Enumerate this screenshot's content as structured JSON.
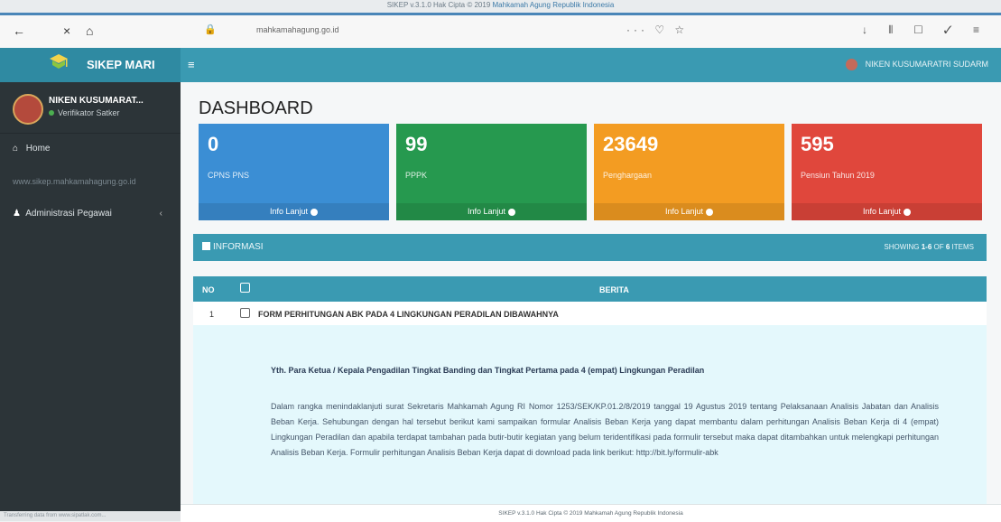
{
  "window": {
    "title_prefix": "SIKEP v.3.1.0 Hak Cipta © 2019",
    "title_org": "Mahkamah Agung Republik Indonesia"
  },
  "browser": {
    "back_icon": "arrow-left-icon",
    "close_icon": "close-icon",
    "home_icon": "home-icon",
    "url": "mahkamahagung.go.id",
    "actions": "··· ♡ ☆",
    "toolbar_icons": "↓ ⫴ ☐ ✓ ≡"
  },
  "app": {
    "brand": "SIKEP MARI",
    "menu_toggle": "≡",
    "top_user": "NIKEN KUSUMARATRI SUDARM"
  },
  "sidebar": {
    "user_name": "NIKEN KUSUMARAT...",
    "user_role": "Verifikator Satker",
    "items": [
      {
        "icon": "home-icon",
        "label": "Home"
      },
      {
        "icon": "",
        "label": "www.sikep.mahkamahagung.go.id"
      },
      {
        "icon": "user-icon",
        "label": "Administrasi Pegawai"
      }
    ],
    "footer": "Transferring data from www.sipatlak.com..."
  },
  "dashboard": {
    "title": "DASHBOARD",
    "boxes": [
      {
        "value": "0",
        "label": "CPNS PNS",
        "link": "Info Lanjut",
        "color": "#3b8ed4"
      },
      {
        "value": "99",
        "label": "PPPK",
        "link": "Info Lanjut",
        "color": "#26994f"
      },
      {
        "value": "23649",
        "label": "Penghargaan",
        "link": "Info Lanjut",
        "color": "#f39c22"
      },
      {
        "value": "595",
        "label": "Pensiun Tahun 2019",
        "link": "Info Lanjut",
        "color": "#e0473c"
      }
    ]
  },
  "info": {
    "title": "INFORMASI",
    "showing_prefix": "SHOWING",
    "showing_range": "1-6",
    "showing_mid": "OF",
    "showing_total": "6",
    "showing_suffix": "ITEMS",
    "col_no": "NO",
    "col_berita": "BERITA",
    "row": {
      "no": "1",
      "title": "FORM PERHITUNGAN ABK PADA 4 LINGKUNGAN PERADILAN DIBAWAHNYA"
    },
    "detail_heading": "Yth. Para Ketua / Kepala Pengadilan Tingkat Banding dan Tingkat Pertama pada 4 (empat) Lingkungan Peradilan",
    "detail_body": "Dalam rangka menindaklanjuti surat Sekretaris Mahkamah Agung RI Nomor 1253/SEK/KP.01.2/8/2019 tanggal 19 Agustus 2019 tentang Pelaksanaan Analisis Jabatan dan Analisis Beban Kerja. Sehubungan dengan hal tersebut berikut kami sampaikan formular Analisis Beban Kerja yang dapat membantu dalam perhitungan Analisis Beban Kerja di 4 (empat) Lingkungan Peradilan dan apabila terdapat tambahan pada butir-butir kegiatan yang belum teridentifikasi pada formulir tersebut maka dapat ditambahkan untuk melengkapi perhitungan Analisis Beban Kerja. Formulir perhitungan Analisis Beban Kerja dapat di download pada link berikut: http://bit.ly/formulir-abk"
  },
  "footer": {
    "text": "SIKEP v.3.1.0 Hak Cipta © 2019",
    "org": "Mahkamah Agung Republik Indonesia"
  }
}
